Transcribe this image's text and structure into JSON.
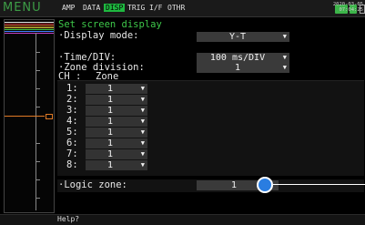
{
  "header": {
    "menu_title": "MENU",
    "tabs": [
      {
        "label": "AMP"
      },
      {
        "label": "DATA"
      },
      {
        "label": "DISP",
        "active": true
      },
      {
        "label": "TRIG"
      },
      {
        "label": "I/F"
      },
      {
        "label": "OTHR"
      }
    ],
    "date": "2020-03-05",
    "time": "07:04:25",
    "icons": [
      "battery-icon",
      "power-icon",
      "sd-card-icon",
      "usb-icon",
      "pen-icon"
    ]
  },
  "settings": {
    "title": "Set screen display",
    "display_mode_label": "·Display mode:",
    "display_mode_value": "Y-T",
    "time_div_label": "·Time/DIV:",
    "time_div_value": "100 ms/DIV",
    "zone_division_label": "·Zone division:",
    "zone_division_value": "1",
    "ch_header": "CH :",
    "zone_header": "Zone",
    "zones": [
      {
        "ch": "1:",
        "zone": "1"
      },
      {
        "ch": "2:",
        "zone": "1"
      },
      {
        "ch": "3:",
        "zone": "1"
      },
      {
        "ch": "4:",
        "zone": "1"
      },
      {
        "ch": "5:",
        "zone": "1"
      },
      {
        "ch": "6:",
        "zone": "1"
      },
      {
        "ch": "7:",
        "zone": "1"
      },
      {
        "ch": "8:",
        "zone": "1"
      }
    ],
    "logic_zone_label": "·Logic zone:",
    "logic_zone_value": "1"
  },
  "footer": {
    "help": "Help?"
  },
  "colors": {
    "accent_green": "#3ec84a",
    "active_tab": "#1fb840",
    "marker_orange": "#e07a25",
    "cursor_blue": "#2a7de1"
  }
}
